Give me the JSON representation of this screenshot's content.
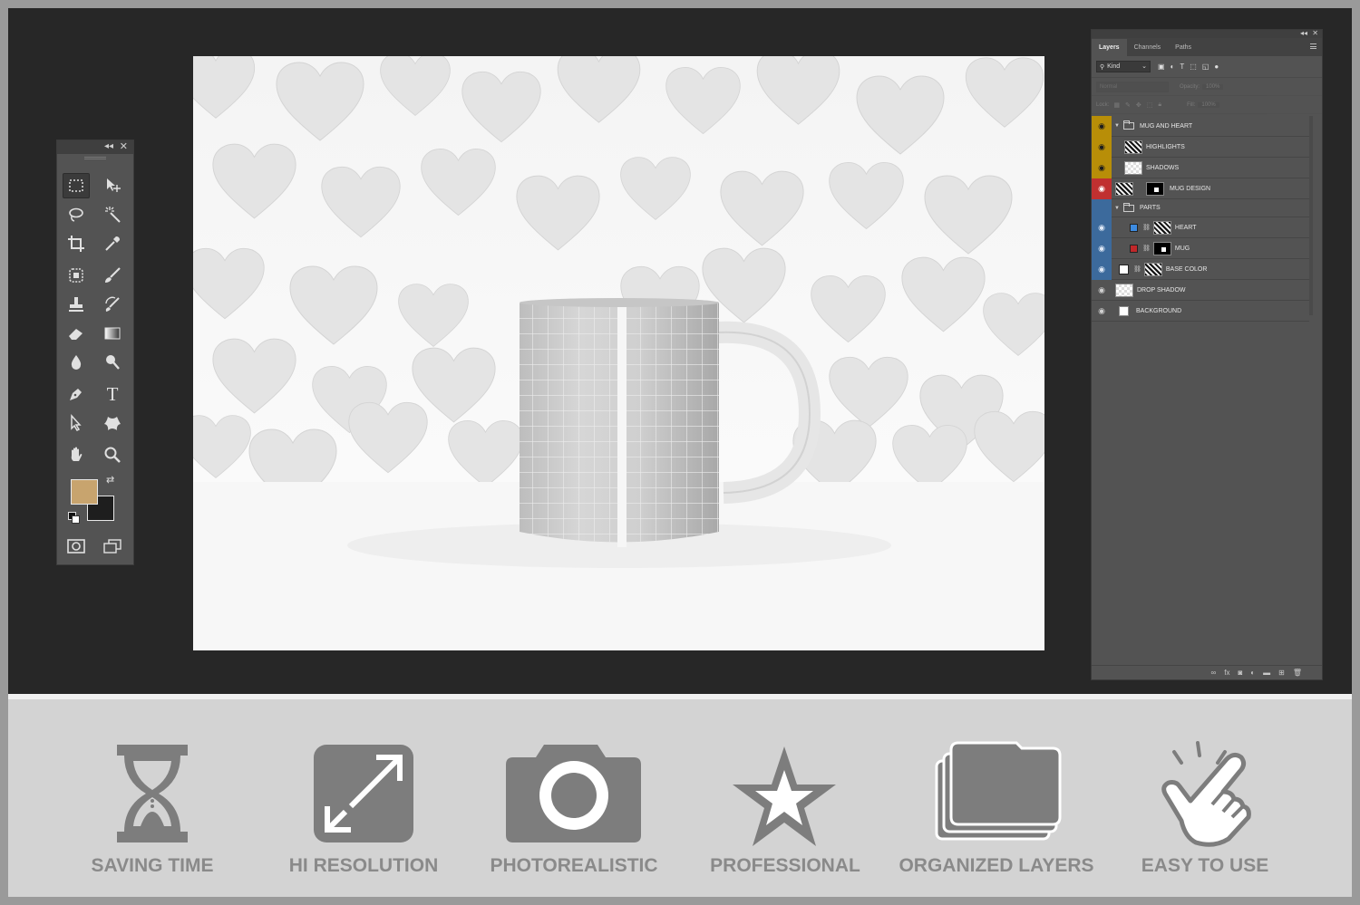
{
  "toolbar": {
    "collapse_glyph": "◂◂",
    "close_glyph": "✕",
    "tools": [
      {
        "name": "rectangular-marquee-tool",
        "icon": "marquee-icon"
      },
      {
        "name": "move-tool",
        "icon": "move-icon"
      },
      {
        "name": "lasso-tool",
        "icon": "lasso-icon"
      },
      {
        "name": "magic-wand-tool",
        "icon": "magic-wand-icon"
      },
      {
        "name": "crop-tool",
        "icon": "crop-icon"
      },
      {
        "name": "eyedropper-tool",
        "icon": "eyedropper-icon"
      },
      {
        "name": "healing-brush-tool",
        "icon": "healing-icon"
      },
      {
        "name": "brush-tool",
        "icon": "brush-icon"
      },
      {
        "name": "clone-stamp-tool",
        "icon": "stamp-icon"
      },
      {
        "name": "history-brush-tool",
        "icon": "history-brush-icon"
      },
      {
        "name": "eraser-tool",
        "icon": "eraser-icon"
      },
      {
        "name": "gradient-tool",
        "icon": "gradient-icon"
      },
      {
        "name": "blur-tool",
        "icon": "blur-icon"
      },
      {
        "name": "dodge-tool",
        "icon": "dodge-icon"
      },
      {
        "name": "pen-tool",
        "icon": "pen-icon"
      },
      {
        "name": "type-tool",
        "icon": "type-icon"
      },
      {
        "name": "path-selection-tool",
        "icon": "path-selection-icon"
      },
      {
        "name": "custom-shape-tool",
        "icon": "shape-icon"
      },
      {
        "name": "hand-tool",
        "icon": "hand-icon"
      },
      {
        "name": "zoom-tool",
        "icon": "zoom-icon"
      }
    ],
    "type_glyph": "T",
    "foreground_color": "#c8a46e",
    "background_color": "#1e1e1e"
  },
  "layers_panel": {
    "collapse_glyph": "◂◂",
    "close_glyph": "✕",
    "tabs": [
      "Layers",
      "Channels",
      "Paths"
    ],
    "filter_kind": "Kind",
    "blend_mode": "Normal",
    "opacity_label": "Opacity:",
    "opacity_value": "100%",
    "lock_label": "Lock:",
    "fill_label": "Fill:",
    "fill_value": "100%",
    "layers": [
      {
        "name": "MUG AND HEART",
        "type": "group",
        "eye": "yellow"
      },
      {
        "name": "HIGHLIGHTS",
        "type": "layer",
        "eye": "yellow"
      },
      {
        "name": "SHADOWS",
        "type": "layer",
        "eye": "yellow"
      },
      {
        "name": "MUG DESIGN",
        "type": "smart-object",
        "eye": "red"
      },
      {
        "name": "PARTS",
        "type": "group",
        "eye": "blue"
      },
      {
        "name": "HEART",
        "type": "color-fill",
        "eye": "blue",
        "color": "#3d8be0"
      },
      {
        "name": "MUG",
        "type": "color-fill",
        "eye": "blue",
        "color": "#c0282a"
      },
      {
        "name": "BASE COLOR",
        "type": "color-fill",
        "eye": "blue",
        "color": "#ffffff"
      },
      {
        "name": "DROP SHADOW",
        "type": "layer",
        "eye": "gray"
      },
      {
        "name": "BACKGROUND",
        "type": "layer",
        "eye": "gray"
      }
    ]
  },
  "features": [
    {
      "label": "SAVING TIME",
      "icon": "hourglass-icon"
    },
    {
      "label": "HI RESOLUTION",
      "icon": "expand-icon"
    },
    {
      "label": "PHOTOREALISTIC",
      "icon": "camera-icon"
    },
    {
      "label": "PROFESSIONAL",
      "icon": "star-icon"
    },
    {
      "label": "ORGANIZED LAYERS",
      "icon": "layers-icon"
    },
    {
      "label": "EASY TO USE",
      "icon": "tap-hand-icon"
    }
  ],
  "colors": {
    "workspace": "#272727",
    "panel": "#535353",
    "feature_bg": "#d3d3d3",
    "feature_icon": "#7d7d7d",
    "feature_text": "#8a8a8a"
  }
}
